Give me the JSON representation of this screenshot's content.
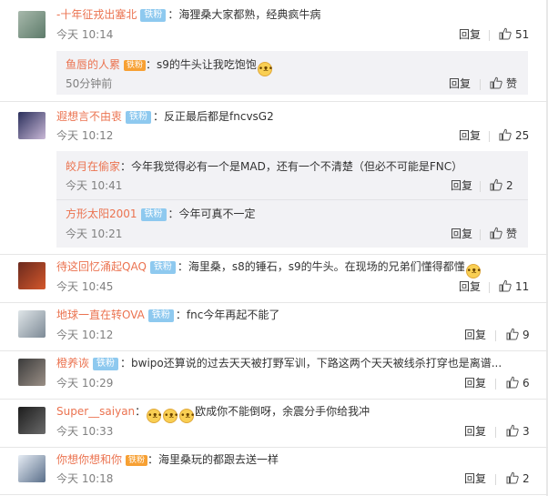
{
  "comments": [
    {
      "user": "-十年征戎出塞北",
      "badge": "铁粉",
      "text": "：海狸桑大家都熟，经典疯牛病",
      "time": "今天 10:14",
      "reply": "回复",
      "likes": "51",
      "avatar_colors": [
        "#a7b8ab",
        "#5d7b6a"
      ],
      "sub": [
        {
          "user": "鱼唇的人累",
          "vip": "铁粉",
          "text": "：s9的牛头让我吃饱饱",
          "emoji_count": 1,
          "time": "50分钟前",
          "reply": "回复",
          "likes": "赞"
        }
      ]
    },
    {
      "user": "遐想言不由衷",
      "badge": "铁粉",
      "text": "：反正最后都是fncvsG2",
      "time": "今天 10:12",
      "reply": "回复",
      "likes": "25",
      "avatar_colors": [
        "#2a2f5c",
        "#c9b8d6"
      ],
      "sub": [
        {
          "user": "皎月在偷家",
          "text": "：今年我觉得必有一个是MAD，还有一个不清楚（但必不可能是FNC）",
          "time": "今天 10:41",
          "reply": "回复",
          "likes": "2"
        },
        {
          "user": "方形太阳2001",
          "badge": "铁粉",
          "text": "：今年可真不一定",
          "time": "今天 10:21",
          "reply": "回复",
          "likes": "赞"
        }
      ]
    },
    {
      "user": "待这回忆涌起QAQ",
      "badge": "铁粉",
      "text": "：海里桑，s8的锤石，s9的牛头。在现场的兄弟们懂得都懂",
      "emoji_count": 1,
      "time": "今天 10:45",
      "reply": "回复",
      "likes": "11",
      "avatar_colors": [
        "#6b2a1e",
        "#d4572b"
      ]
    },
    {
      "user": "地球一直在转OVA",
      "badge": "铁粉",
      "text": "：fnc今年再起不能了",
      "time": "今天 10:12",
      "reply": "回复",
      "likes": "9",
      "avatar_colors": [
        "#dfe5e8",
        "#7d8a96"
      ]
    },
    {
      "user": "橙养诙",
      "badge": "铁粉",
      "text": "：bwipo还算说的过去天天被打野军训，下路这两个天天被线杀打穿也是离谱...",
      "time": "今天 10:29",
      "reply": "回复",
      "likes": "6",
      "avatar_colors": [
        "#3b3b3b",
        "#9a8f86"
      ]
    },
    {
      "user": "Super__saiyan",
      "text": "：",
      "emoji_count": 3,
      "text2": "欧成你不能倒呀，余震分手你给我冲",
      "time": "今天 10:33",
      "reply": "回复",
      "likes": "3",
      "avatar_colors": [
        "#1d1d1d",
        "#6a6a6a"
      ]
    },
    {
      "user": "你想你想和你",
      "vip": "铁粉",
      "text": "：海里桑玩的都跟去送一样",
      "time": "今天 10:18",
      "reply": "回复",
      "likes": "2",
      "avatar_colors": [
        "#e6ecf4",
        "#5a6f8a"
      ]
    }
  ],
  "colors": {
    "username": "#eb7350",
    "badge": "#8ec9ef",
    "vip": "#f7a033",
    "time": "#808080",
    "subbox": "#f2f2f5"
  },
  "icons": {
    "like": "thumbs-up-icon",
    "emoji": "doge-emoji-icon"
  }
}
